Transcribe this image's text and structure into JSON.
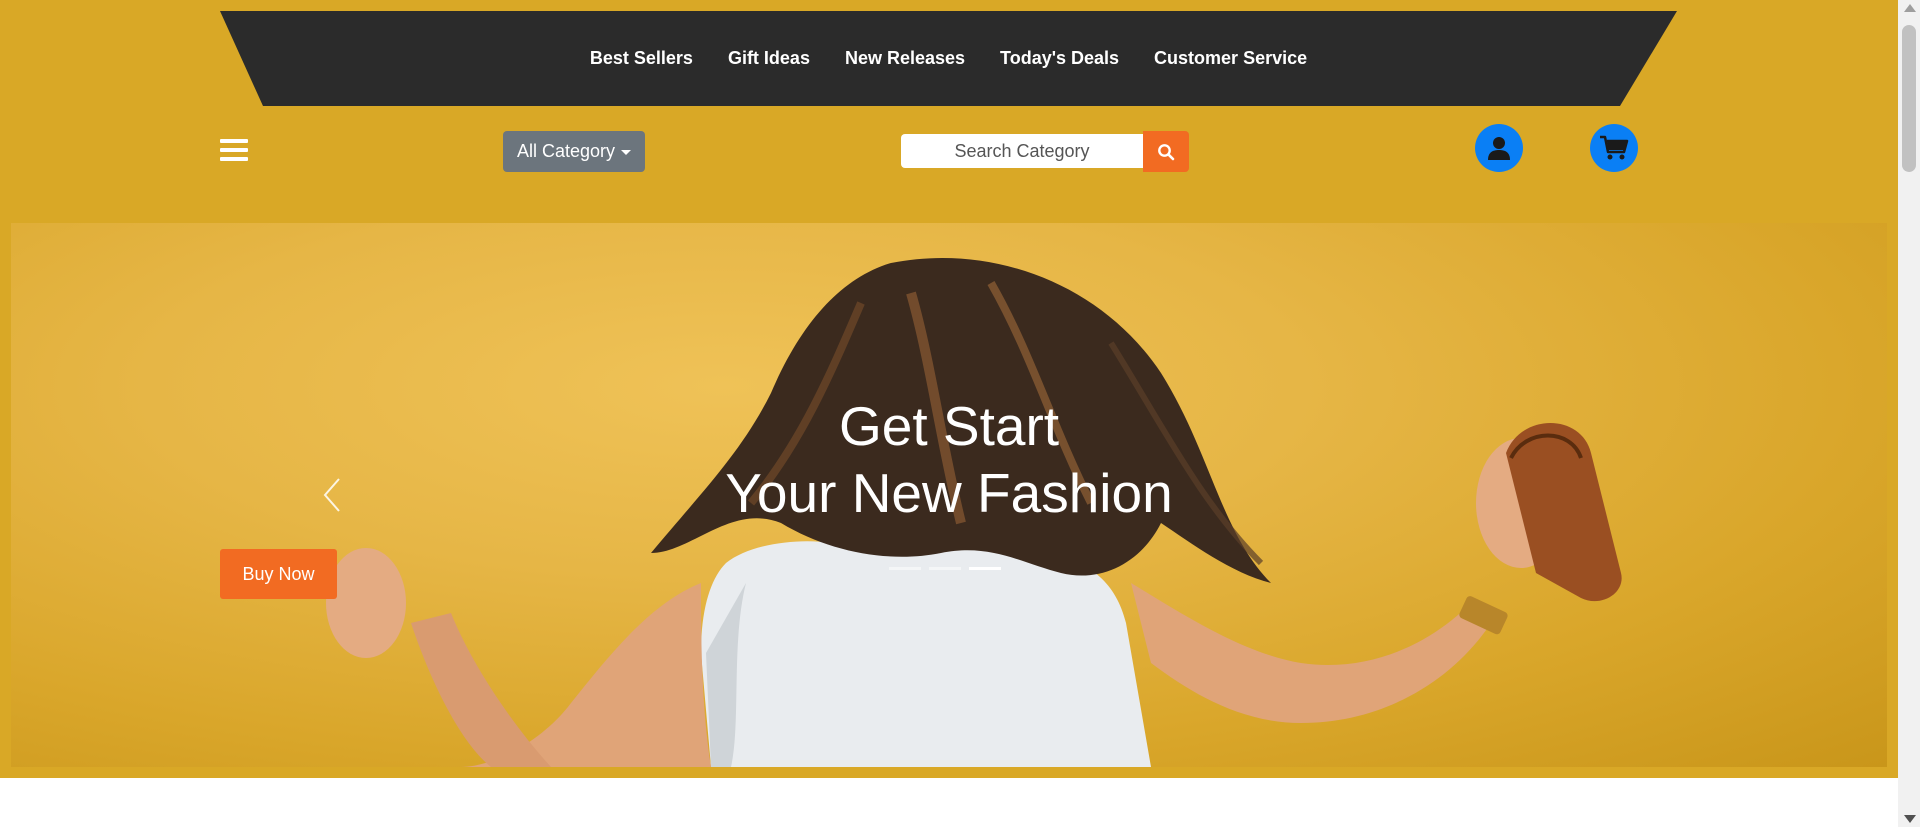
{
  "colors": {
    "page_background": "#d9a826",
    "nav_background": "#2b2b2b",
    "accent_orange": "#f26b22",
    "icon_blue": "#0a7ff5",
    "category_gray": "#6c757d"
  },
  "top_nav": {
    "links": [
      "Best Sellers",
      "Gift Ideas",
      "New Releases",
      "Today's Deals",
      "Customer Service"
    ]
  },
  "header": {
    "menu_icon": "hamburger-icon",
    "category_button": "All Category",
    "search": {
      "placeholder": "Search Category",
      "icon": "search-icon"
    },
    "user_icon": "user-icon",
    "cart_icon": "cart-icon"
  },
  "hero": {
    "title_line1": "Get Start",
    "title_line2": "Your New Fashion",
    "cta": "Buy Now",
    "prev_icon": "chevron-left-icon",
    "slides_count": 3,
    "active_slide": 3
  }
}
